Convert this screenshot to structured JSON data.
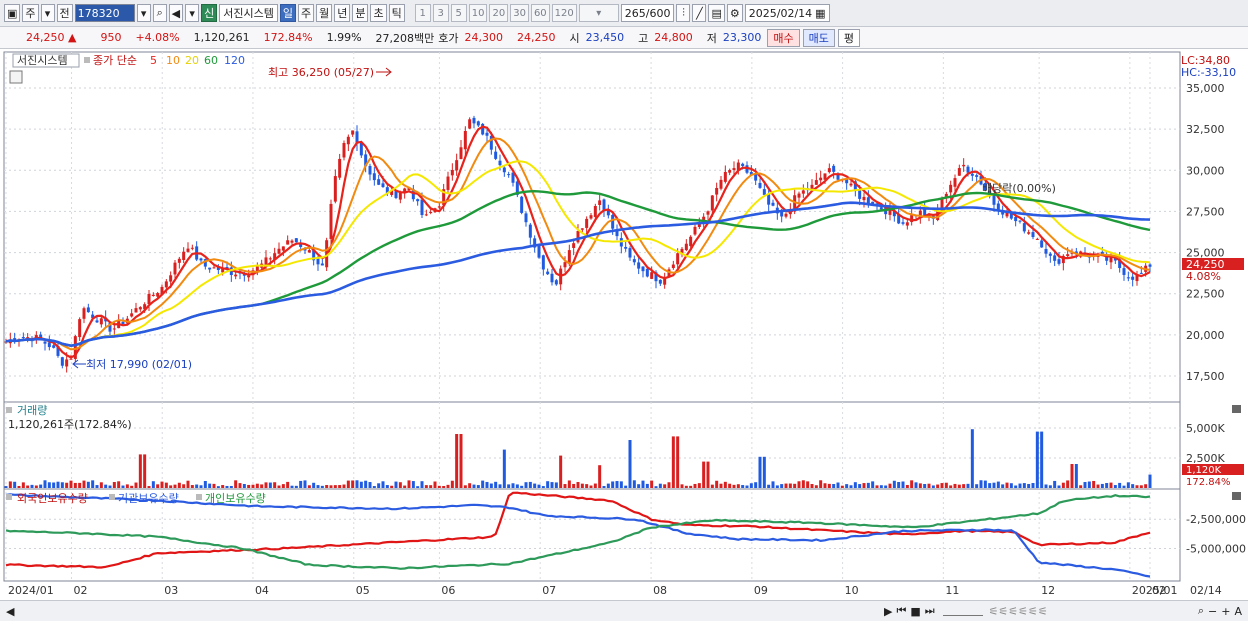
{
  "toolbar": {
    "market": "주",
    "prev": "전",
    "code": "178320",
    "info_btn": "신",
    "stock_name": "서진시스템",
    "periods": [
      "일",
      "주",
      "월",
      "년",
      "분",
      "초",
      "틱"
    ],
    "active_period": "일",
    "nums": [
      "1",
      "3",
      "5",
      "10",
      "20",
      "30",
      "60",
      "120"
    ],
    "count": "265",
    "count_total": "/600",
    "date": "2025/02/14"
  },
  "quote": {
    "price": "24,250",
    "arrow": "▲",
    "change": "950",
    "change_pct": "+4.08%",
    "volume": "1,120,261",
    "vol_ratio": "172.84%",
    "turnover": "1.99%",
    "amount": "27,208백만",
    "ask_label": "호가",
    "ask": "24,300",
    "bid": "24,250",
    "open_label": "시",
    "open": "23,450",
    "high_label": "고",
    "high": "24,800",
    "low_label": "저",
    "low": "23,300",
    "buy_label": "매수",
    "sell_label": "매도",
    "eval_label": "평"
  },
  "legend": {
    "name": "서진시스템",
    "ma_label": "종가 단순",
    "ma": [
      {
        "period": "5",
        "color": "#e8231c"
      },
      {
        "period": "10",
        "color": "#f28a10"
      },
      {
        "period": "20",
        "color": "#f5e800"
      },
      {
        "period": "60",
        "color": "#1f9a3a"
      },
      {
        "period": "120",
        "color": "#2b5be0"
      }
    ]
  },
  "annotations": {
    "high": "최고 36,250 (05/27)",
    "low": "최저 17,990 (02/01)",
    "exright": "배당락(0.00%)",
    "lc": "LC:34,80",
    "hc": "HC:-33,10",
    "price_tag": "24,250",
    "pct_tag": "4.08%",
    "vol_title": "거래량",
    "vol_info": "1,120,261주(172.84%)",
    "vol_tag": "1,120K",
    "vol_pct_tag": "172.84%",
    "hold_foreign": "외국인보유수량",
    "hold_inst": "기관보유수량",
    "hold_indiv": "개인보유수량"
  },
  "chart_data": {
    "type": "candlestick",
    "price_ticks": [
      "35,000",
      "32,500",
      "30,000",
      "27,500",
      "25,000",
      "22,500",
      "20,000",
      "17,500"
    ],
    "volume_ticks": [
      "5,000K",
      "2,500K"
    ],
    "holding_ticks": [
      "-2,500,000",
      "-5,000,000"
    ],
    "x_labels": [
      "2024/01",
      "02",
      "03",
      "04",
      "05",
      "06",
      "07",
      "08",
      "09",
      "10",
      "11",
      "12",
      "2025/01",
      "02",
      "02/14"
    ],
    "price_close": [
      [
        0,
        19600
      ],
      [
        0.03,
        19900
      ],
      [
        0.06,
        19800
      ],
      [
        0.09,
        19300
      ],
      [
        0.11,
        18300
      ],
      [
        0.13,
        18700
      ],
      [
        0.15,
        21700
      ],
      [
        0.18,
        21000
      ],
      [
        0.21,
        20300
      ],
      [
        0.24,
        21000
      ],
      [
        0.27,
        21900
      ],
      [
        0.31,
        22900
      ],
      [
        0.34,
        24500
      ],
      [
        0.36,
        25500
      ],
      [
        0.39,
        24200
      ],
      [
        0.42,
        24000
      ],
      [
        0.45,
        23800
      ],
      [
        0.48,
        23800
      ],
      [
        0.51,
        24300
      ],
      [
        0.54,
        25200
      ],
      [
        0.57,
        25800
      ],
      [
        0.6,
        25100
      ],
      [
        0.63,
        24000
      ],
      [
        0.65,
        29000
      ],
      [
        0.67,
        31500
      ],
      [
        0.69,
        32500
      ],
      [
        0.71,
        30500
      ],
      [
        0.74,
        29000
      ],
      [
        0.77,
        28500
      ],
      [
        0.8,
        29000
      ],
      [
        0.83,
        27000
      ],
      [
        0.86,
        28000
      ],
      [
        0.89,
        30500
      ],
      [
        0.92,
        33000
      ],
      [
        0.95,
        32200
      ],
      [
        0.97,
        31000
      ],
      [
        1.0,
        29600
      ],
      [
        1.03,
        27000
      ],
      [
        1.06,
        24500
      ],
      [
        1.09,
        23000
      ],
      [
        1.12,
        25500
      ],
      [
        1.15,
        27000
      ],
      [
        1.18,
        28300
      ],
      [
        1.21,
        26000
      ],
      [
        1.24,
        24500
      ],
      [
        1.27,
        23800
      ],
      [
        1.3,
        23300
      ],
      [
        1.33,
        24800
      ],
      [
        1.36,
        26000
      ],
      [
        1.39,
        27500
      ],
      [
        1.42,
        29500
      ],
      [
        1.45,
        30300
      ],
      [
        1.48,
        29700
      ],
      [
        1.51,
        28000
      ],
      [
        1.54,
        27000
      ],
      [
        1.57,
        28500
      ],
      [
        1.6,
        29000
      ],
      [
        1.63,
        30000
      ],
      [
        1.66,
        29500
      ],
      [
        1.69,
        28500
      ],
      [
        1.72,
        28000
      ],
      [
        1.75,
        27500
      ],
      [
        1.78,
        26800
      ],
      [
        1.81,
        27500
      ],
      [
        1.84,
        27000
      ],
      [
        1.87,
        29000
      ],
      [
        1.9,
        30300
      ],
      [
        1.93,
        29500
      ],
      [
        1.96,
        28000
      ],
      [
        1.99,
        27200
      ],
      [
        2.02,
        26500
      ],
      [
        2.05,
        25800
      ],
      [
        2.08,
        24300
      ],
      [
        2.11,
        25100
      ],
      [
        2.14,
        24900
      ],
      [
        2.17,
        24700
      ],
      [
        2.2,
        24400
      ],
      [
        2.23,
        23500
      ],
      [
        2.25,
        23600
      ],
      [
        2.27,
        24250
      ]
    ],
    "volume_k": [
      [
        0.27,
        2800
      ],
      [
        0.9,
        4500
      ],
      [
        0.99,
        3200
      ],
      [
        1.1,
        2700
      ],
      [
        1.18,
        1900
      ],
      [
        1.24,
        4000
      ],
      [
        1.33,
        4300
      ],
      [
        1.39,
        2200
      ],
      [
        1.5,
        2600
      ],
      [
        1.92,
        4900
      ],
      [
        2.05,
        4700
      ],
      [
        2.12,
        2000
      ],
      [
        2.27,
        1120
      ]
    ],
    "holding_foreign": [
      [
        0,
        -6400
      ],
      [
        0.2,
        -6600
      ],
      [
        0.3,
        -5400
      ],
      [
        0.55,
        -5000
      ],
      [
        0.97,
        -4000
      ],
      [
        1.0,
        -200
      ],
      [
        1.2,
        -900
      ],
      [
        1.28,
        -2500
      ],
      [
        1.35,
        -3000
      ],
      [
        1.48,
        -3100
      ],
      [
        1.6,
        -3400
      ],
      [
        1.78,
        -3800
      ],
      [
        1.9,
        -3500
      ],
      [
        2.0,
        -3600
      ],
      [
        2.05,
        -4700
      ],
      [
        2.2,
        -4500
      ],
      [
        2.27,
        -3600
      ]
    ],
    "holding_inst": [
      [
        0,
        -400
      ],
      [
        0.3,
        -900
      ],
      [
        0.5,
        -1400
      ],
      [
        0.78,
        -1600
      ],
      [
        0.93,
        -1300
      ],
      [
        1.0,
        -1500
      ],
      [
        1.07,
        -2200
      ],
      [
        1.25,
        -2500
      ],
      [
        1.35,
        -3700
      ],
      [
        1.45,
        -4200
      ],
      [
        1.62,
        -4300
      ],
      [
        1.78,
        -3500
      ],
      [
        1.95,
        -3400
      ],
      [
        2.0,
        -3500
      ],
      [
        2.05,
        -6200
      ],
      [
        2.2,
        -6800
      ],
      [
        2.27,
        -7400
      ]
    ],
    "holding_indiv": [
      [
        0,
        -3500
      ],
      [
        0.15,
        -3700
      ],
      [
        0.3,
        -4000
      ],
      [
        0.47,
        -5000
      ],
      [
        0.6,
        -6400
      ],
      [
        0.78,
        -6700
      ],
      [
        1.0,
        -6300
      ],
      [
        1.2,
        -4500
      ],
      [
        1.28,
        -3200
      ],
      [
        1.4,
        -2600
      ],
      [
        1.6,
        -2800
      ],
      [
        1.8,
        -3200
      ],
      [
        1.95,
        -2500
      ],
      [
        2.05,
        -2000
      ],
      [
        2.1,
        -900
      ],
      [
        2.2,
        -500
      ],
      [
        2.27,
        -600
      ]
    ]
  }
}
